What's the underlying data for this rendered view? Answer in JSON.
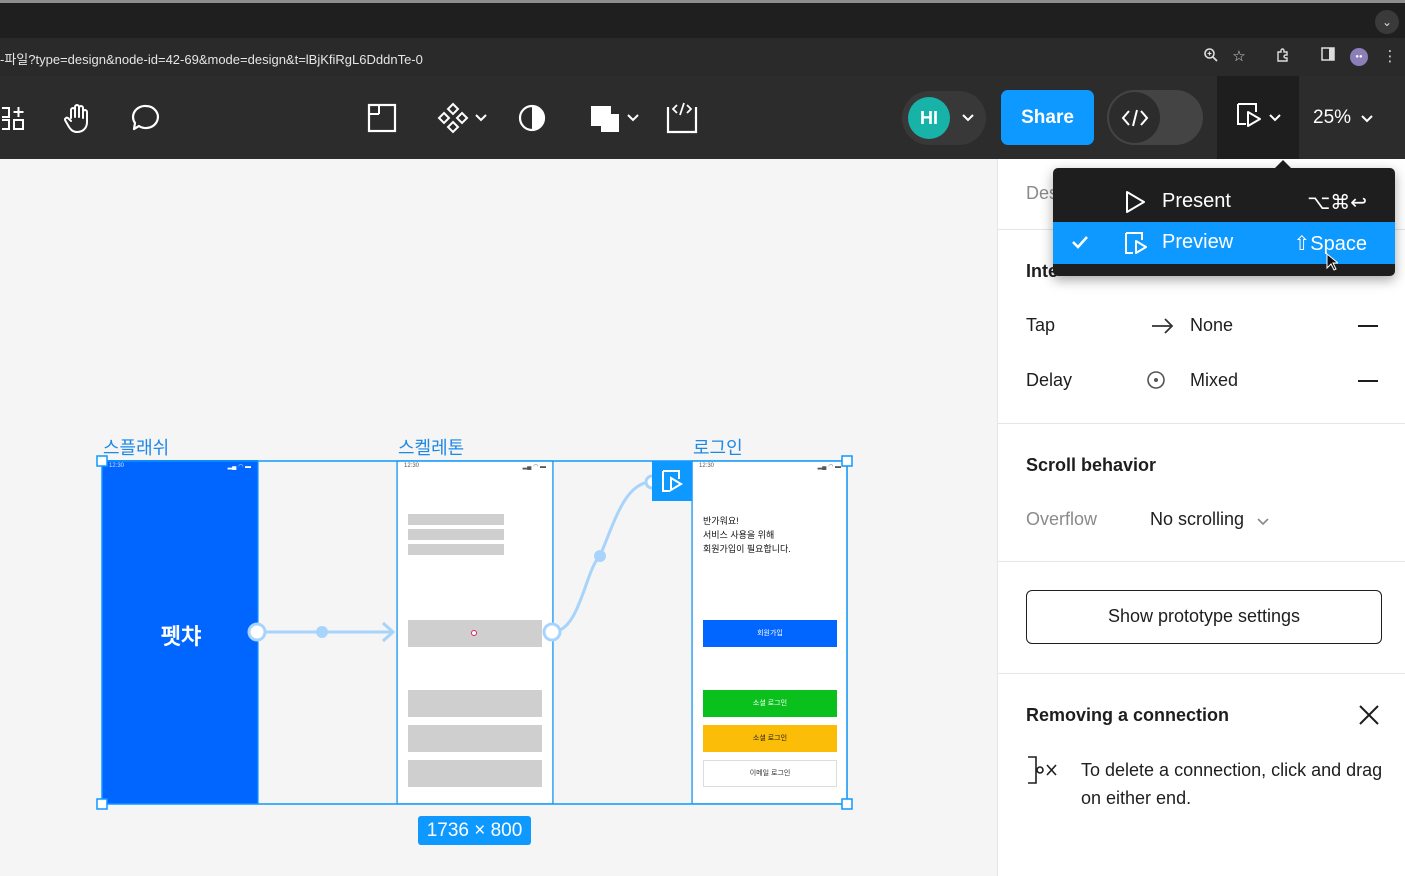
{
  "browser": {
    "url": "-파일?type=design&node-id=42-69&mode=design&t=lBjKfiRgL6DddnTe-0"
  },
  "toolbar": {
    "avatar_initials": "HI",
    "share_label": "Share",
    "zoom": "25%"
  },
  "present_menu": {
    "items": [
      {
        "label": "Present",
        "shortcut": "⌥⌘↩",
        "selected": false
      },
      {
        "label": "Preview",
        "shortcut": "⇧Space",
        "selected": true
      }
    ]
  },
  "canvas": {
    "frames": [
      {
        "label": "스플래쉬",
        "title": "펫챠"
      },
      {
        "label": "스켈레톤"
      },
      {
        "label": "로그인",
        "greeting": "반가워요!\n서비스 사용을 위해\n회원가입이 필요합니다.",
        "signup": "회원가입",
        "social1": "소셜 로그인",
        "social2": "소셜 로그인",
        "email": "이메일 로그인"
      }
    ],
    "status_time": "12:30",
    "selection_size": "1736 × 800"
  },
  "panel": {
    "tab_partial": "Des",
    "interactions_partial": "Inte",
    "tap_label": "Tap",
    "tap_value": "None",
    "delay_label": "Delay",
    "delay_value": "Mixed",
    "scroll_title": "Scroll behavior",
    "overflow_label": "Overflow",
    "overflow_value": "No scrolling",
    "proto_button": "Show prototype settings",
    "hint_title": "Removing a connection",
    "hint_text": "To delete a connection, click and drag on either end."
  },
  "colors": {
    "accent": "#0d99ff",
    "frame_blue": "#0066ff",
    "green": "#0ac01d",
    "yellow": "#fbbd08"
  }
}
